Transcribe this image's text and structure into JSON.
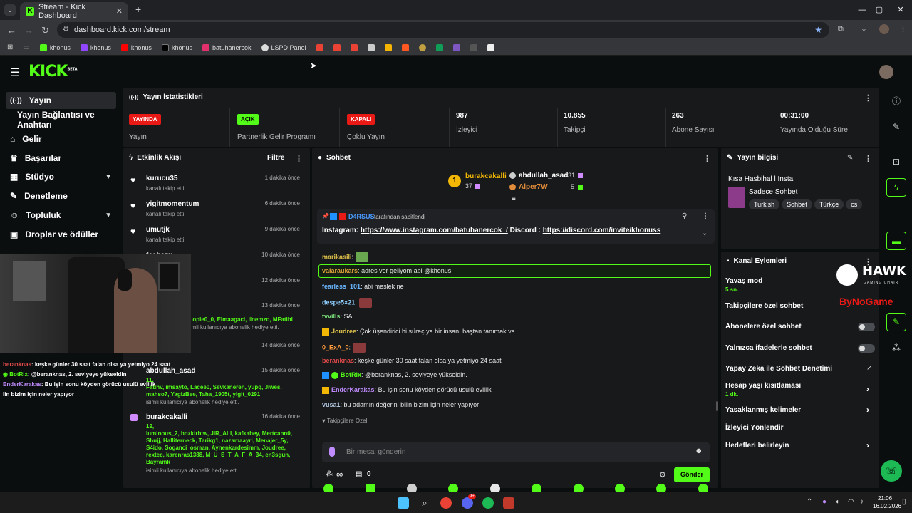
{
  "browser": {
    "tab_title": "Stream - Kick Dashboard",
    "url": "dashboard.kick.com/stream",
    "bookmarks": [
      "khonus",
      "khonus",
      "khonus",
      "khonus",
      "batuhanercok",
      "LSPD Panel"
    ]
  },
  "app": {
    "logo": "KICK",
    "logo_sup": "BETA"
  },
  "sidebar": {
    "items": [
      {
        "label": "Yayın",
        "icon": "broadcast-icon"
      },
      {
        "label": "Yayın Bağlantısı ve Anahtarı",
        "icon": ""
      },
      {
        "label": "Gelir",
        "icon": "bank-icon"
      },
      {
        "label": "Başarılar",
        "icon": "trophy-icon"
      },
      {
        "label": "Stüdyo",
        "icon": "studio-icon"
      },
      {
        "label": "Denetleme",
        "icon": "wrench-icon"
      },
      {
        "label": "Topluluk",
        "icon": "people-icon"
      },
      {
        "label": "Droplar ve ödüller",
        "icon": "gift-icon"
      }
    ]
  },
  "stats": {
    "title": "Yayın İstatistikleri",
    "items": [
      {
        "badge": "YAYINDA",
        "label": "Yayın"
      },
      {
        "badge": "AÇIK",
        "label": "Partnerlik Gelir Programı"
      },
      {
        "badge": "KAPALI",
        "label": "Çoklu Yayın"
      },
      {
        "value": "987",
        "label": "İzleyici"
      },
      {
        "value": "10.855",
        "label": "Takipçi"
      },
      {
        "value": "263",
        "label": "Abone Sayısı"
      },
      {
        "value": "00:31:00",
        "label": "Yayında Olduğu Süre"
      }
    ]
  },
  "events": {
    "title": "Etkinlik Akışı",
    "filter": "Filtre",
    "items": [
      {
        "name": "kurucu35",
        "sub": "kanalı takip etti",
        "time": "1 dakika önce"
      },
      {
        "name": "yigitmomentum",
        "sub": "kanalı takip etti",
        "time": "6 dakika önce"
      },
      {
        "name": "umutjk",
        "sub": "kanalı takip etti",
        "time": "9 dakika önce"
      },
      {
        "name": "fcebazu",
        "sub": "",
        "time": "10 dakika önce"
      },
      {
        "name": "",
        "sub": "",
        "time": "12 dakika önce"
      },
      {
        "name": "",
        "sub": "",
        "time": "13 dakika önce"
      },
      {
        "name": "",
        "sub": "",
        "time": "14 dakika önce"
      },
      {
        "name": "abdullah_asad",
        "sub": "isimli kullanıcıya abonelik hediye etti.",
        "time": "15 dakika önce"
      },
      {
        "name": "burakcakalli",
        "sub": "isimli kullanıcıya abonelik hediye etti.",
        "time": "16 dakika önce"
      }
    ],
    "gift_names_1": "lt, opie0_0, Elmaagaci, ilnemzo, MFatihl",
    "gift_sub_1": "isimli kullanıcıya abonelik hediye etti.",
    "gift_names_2a": "11,",
    "gift_names_2b": "Fatihv, imsayto, Lacee0, Sevkaneren, yupq, Jiwes,",
    "gift_names_2c": "mahso7, YagizBee, Taha_1905t, yigit_0291",
    "gift_names_3a": "19,",
    "gift_names_3b": "luminous_2, bozkirbtw, JIR_ALI, kafkabey, Mertcann0,",
    "gift_names_3c": "Shujj, Halliterneck, Tarikg1, nazamaayri, Menajer_5y,",
    "gift_names_3d": "S4ido, Soganci_osman, Aynenkardesimm, Joudree,",
    "gift_names_3e": "rextec, karenras1388, M_U_S_T_A_F_A_34, en3sgun,",
    "gift_names_3f": "Bayramk"
  },
  "chat": {
    "title": "Sohbet",
    "leaders": [
      {
        "rank": "1",
        "name": "burakcakalli",
        "count": "37"
      },
      {
        "name": "abdullah_asad",
        "count": "31"
      },
      {
        "name": "Alper7W",
        "count": "5"
      }
    ],
    "pinned_by": "D4RSUS",
    "pinned_suffix": "tarafından sabitlendi",
    "pinned_prefix1": "Instagram: ",
    "pinned_link1": "https://www.instagram.com/batuhanercok_/",
    "pinned_prefix2": " Discord : ",
    "pinned_link2": "https://discord.com/invite/khonuss",
    "messages": [
      {
        "user": "marikasili",
        "text": "",
        "color": "#e0c34a"
      },
      {
        "user": "valaraukars",
        "text": "adres ver geliyom abi @khonus",
        "color": "#e0a03a"
      },
      {
        "user": "fearless_101",
        "text": "abi meslek ne",
        "color": "#6ab7ff"
      },
      {
        "user": "despe5×21",
        "text": "",
        "color": "#8fd0ff"
      },
      {
        "user": "tvvills",
        "text": "SA",
        "color": "#7ae07a"
      },
      {
        "user": "Joudree",
        "text": "Çok üşendirici bi süreç ya bir insanı baştan tanımak vs.",
        "color": "#e0c34a"
      },
      {
        "user": "0_ExA_0",
        "text": "",
        "color": "#ff9b3a"
      },
      {
        "user": "beranknas",
        "text": "keşke günler 30 saat falan olsa ya yetmiyo 24 saat",
        "color": "#e04a4a"
      },
      {
        "user": "BotRix",
        "text": "@beranknas, 2. seviyeye yükseldin.",
        "color": "#53fc18"
      },
      {
        "user": "EnderKarakas",
        "text": "Bu işin sonu köyden görücü usulü evlilik",
        "color": "#c08cff"
      },
      {
        "user": "vusa1",
        "text": "bu adamın değerini bilin bizim için neler yapıyor",
        "color": "#b0c4de"
      }
    ],
    "followers_only": "Takipçilere Özel",
    "input_placeholder": "Bir mesaj gönderin",
    "points": "∞",
    "count": "0",
    "send": "Gönder"
  },
  "stream_info": {
    "title": "Yayın bilgisi",
    "stream_title": "Kısa Hasbihal l İnsta",
    "category": "Sadece Sohbet",
    "tags": [
      "Turkish",
      "Sohbet",
      "Türkçe",
      "cs"
    ]
  },
  "channel_actions": {
    "title": "Kanal Eylemleri",
    "slow_mode": "Yavaş mod",
    "slow_mode_val": "5 sn.",
    "followers_chat": "Takipçilere özel sohbet",
    "subs_chat": "Abonelere özel sohbet",
    "emote_chat": "Yalnızca ifadelerle sohbet",
    "ai_moderation": "Yapay Zeka ile Sohbet Denetimi",
    "account_age": "Hesap yaşı kısıtlaması",
    "account_age_val": "1 dk.",
    "banned_words": "Yasaklanmış kelimeler",
    "redirect": "İzleyici Yönlendir",
    "goals": "Hedefleri belirleyin"
  },
  "overlay": {
    "hawk": "HAWK",
    "hawk_sub": "GAMING CHAIR",
    "bynogame": "ByNoGame",
    "chat1_user": "beranknas",
    "chat1_text": "keşke günler 30 saat falan olsa ya yetmiyo 24 saat",
    "chat2_user": "BotRix",
    "chat2_text": "@beranknas, 2. seviyeye yükseldin",
    "chat3_user": "EnderKarakas",
    "chat3_text": "Bu işin sonu köyden görücü usulü evlilik",
    "chat3_cont": "lin bizim için neler yapıyor"
  },
  "taskbar": {
    "time": "21:06",
    "date": "16.02.2026",
    "badge": "9+"
  },
  "colors": {
    "accent": "#53fc18",
    "live": "#e91916",
    "panel": "#18191b",
    "bg": "#0b0e0f"
  }
}
